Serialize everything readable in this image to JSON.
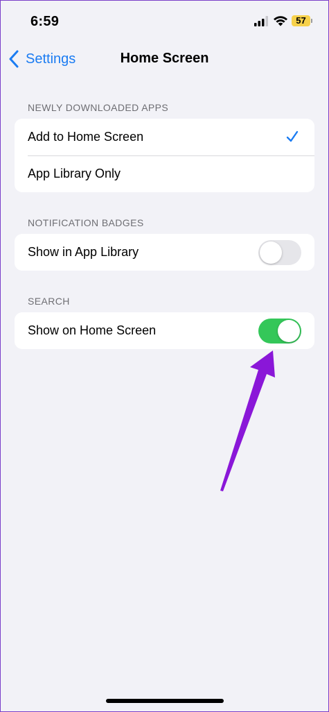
{
  "status_bar": {
    "time": "6:59",
    "battery_level": "57",
    "battery_color": "#f7d14b",
    "icons": [
      "cellular-signal-icon",
      "wifi-icon",
      "battery-icon"
    ]
  },
  "nav": {
    "back_label": "Settings",
    "title": "Home Screen",
    "accent_color": "#1b7cf2"
  },
  "sections": {
    "newly_downloaded": {
      "header": "NEWLY DOWNLOADED APPS",
      "options": [
        {
          "label": "Add to Home Screen",
          "selected": true
        },
        {
          "label": "App Library Only",
          "selected": false
        }
      ]
    },
    "notification_badges": {
      "header": "NOTIFICATION BADGES",
      "row_label": "Show in App Library",
      "toggle_on": false
    },
    "search": {
      "header": "SEARCH",
      "row_label": "Show on Home Screen",
      "toggle_on": true,
      "toggle_color": "#34c759"
    }
  },
  "annotation": {
    "arrow_color": "#8a17d8",
    "points_to": "search-toggle"
  }
}
